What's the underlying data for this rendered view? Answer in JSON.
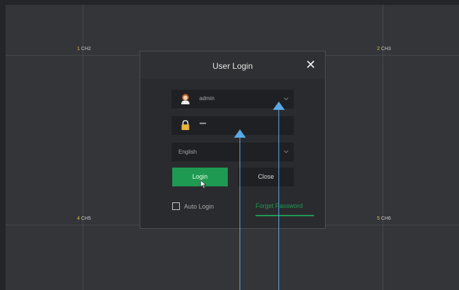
{
  "channels": [
    {
      "num": "1",
      "label": "CH2"
    },
    {
      "num": "2",
      "label": "CH3"
    },
    {
      "num": "4",
      "label": "CH5"
    },
    {
      "num": "5",
      "label": "CH6"
    }
  ],
  "dialog": {
    "title": "User Login",
    "close_glyph": "✕",
    "username": "admin",
    "password_mask": "•••••",
    "language": "English",
    "login_label": "Login",
    "close_label": "Close",
    "auto_login_label": "Auto Login",
    "forgot_password_label": "Forget Password"
  },
  "icons": [
    "user-avatar-icon",
    "lock-icon",
    "chevron-down-icon"
  ],
  "colors": {
    "accent": "#1f9a52",
    "annotation_arrow": "#5aa9e6"
  }
}
